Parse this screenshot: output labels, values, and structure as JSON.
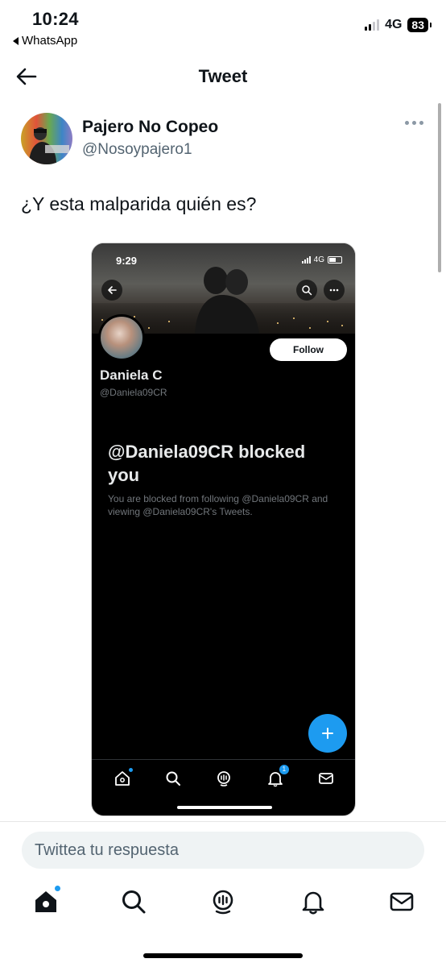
{
  "status_bar": {
    "time": "10:24",
    "back_app": "WhatsApp",
    "network": "4G",
    "battery": "83"
  },
  "header": {
    "title": "Tweet"
  },
  "tweet": {
    "author_name": "Pajero No Copeo",
    "author_handle": "@Nosoypajero1",
    "text": "¿Y esta malparida quién es?"
  },
  "embedded_screenshot": {
    "time": "9:29",
    "network": "4G",
    "follow_label": "Follow",
    "name": "Daniela C",
    "handle": "@Daniela09CR",
    "blocked_title": "@Daniela09CR blocked you",
    "blocked_description": "You are blocked from following @Daniela09CR and viewing @Daniela09CR's Tweets.",
    "notification_badge": "1",
    "nav_icons": [
      "home-icon",
      "search-icon",
      "spaces-icon",
      "notifications-icon",
      "messages-icon"
    ]
  },
  "reply": {
    "placeholder": "Twittea tu respuesta"
  },
  "bottom_nav": {
    "items": [
      "home-icon",
      "search-icon",
      "spaces-icon",
      "notifications-icon",
      "messages-icon"
    ]
  },
  "colors": {
    "accent": "#1d9bf0",
    "text": "#0f1419",
    "secondary_text": "#536471"
  }
}
